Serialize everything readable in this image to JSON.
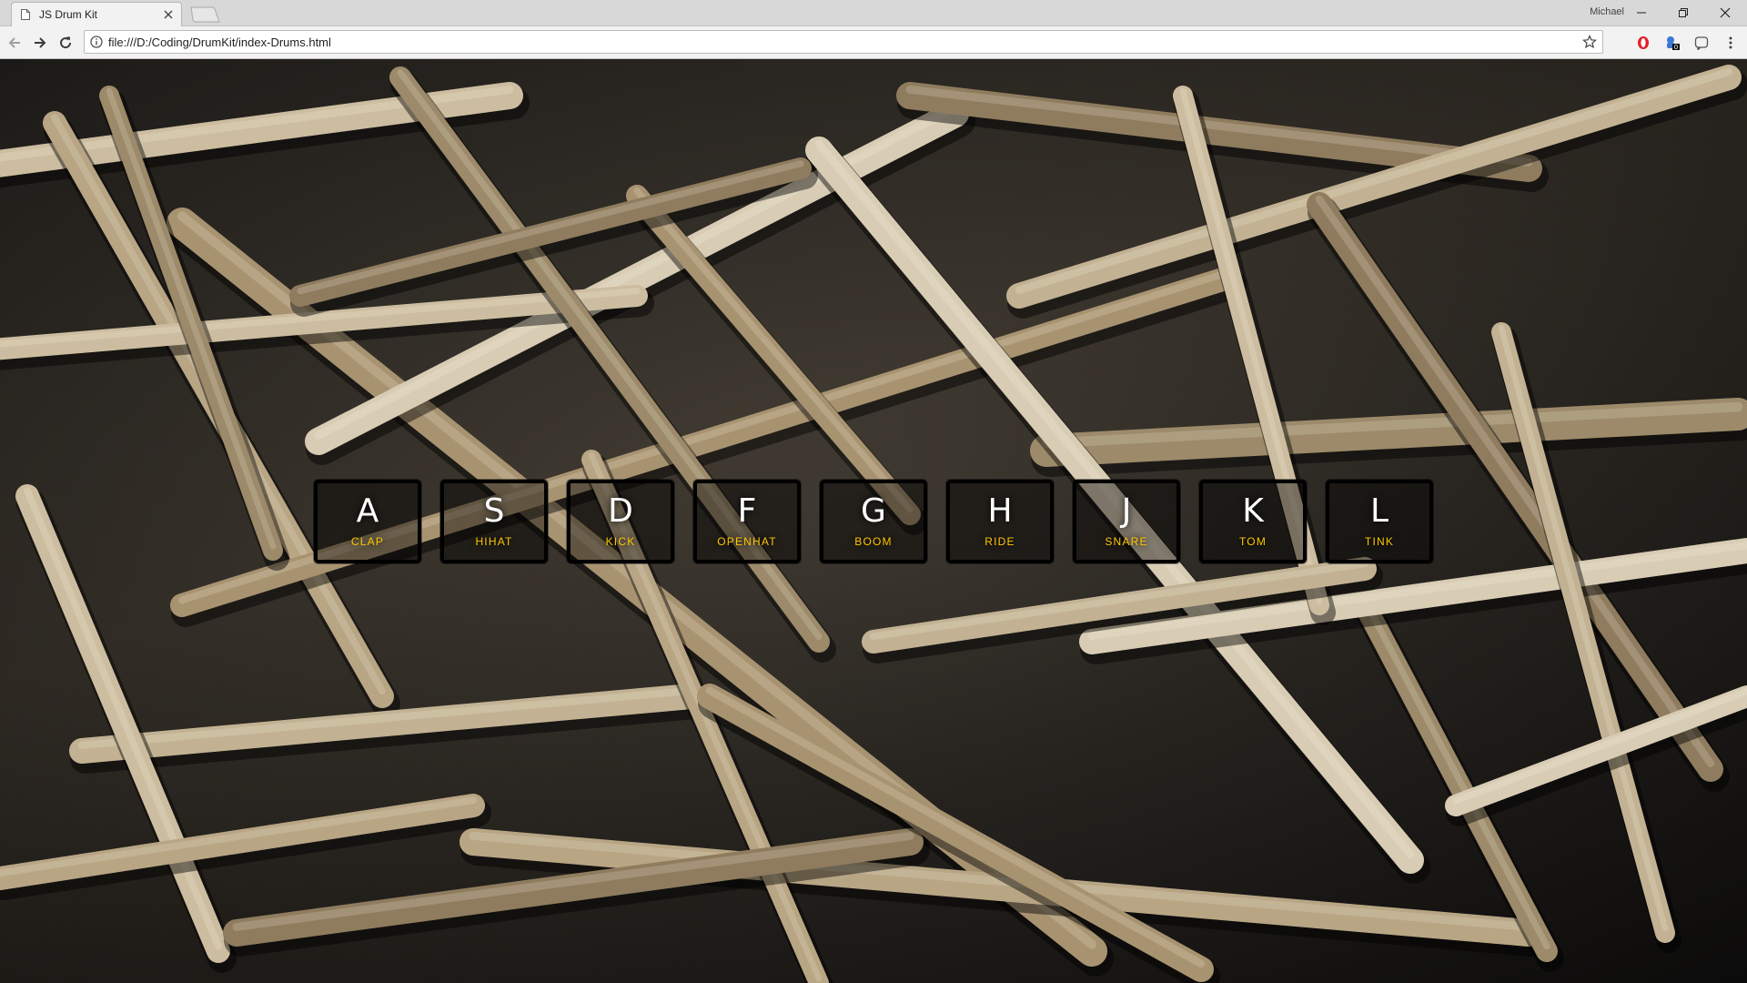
{
  "browser": {
    "tab_title": "JS Drum Kit",
    "url": "file:///D:/Coding/DrumKit/index-Drums.html",
    "profile_name": "Michael",
    "extension_badge": "0"
  },
  "colors": {
    "key_label": "#ffc600",
    "key_letter": "#ffffff",
    "key_border": "#000000"
  },
  "keys": [
    {
      "letter": "A",
      "sound": "CLAP"
    },
    {
      "letter": "S",
      "sound": "HIHAT"
    },
    {
      "letter": "D",
      "sound": "KICK"
    },
    {
      "letter": "F",
      "sound": "OPENHAT"
    },
    {
      "letter": "G",
      "sound": "BOOM"
    },
    {
      "letter": "H",
      "sound": "RIDE"
    },
    {
      "letter": "J",
      "sound": "SNARE"
    },
    {
      "letter": "K",
      "sound": "TOM"
    },
    {
      "letter": "L",
      "sound": "TINK"
    }
  ]
}
